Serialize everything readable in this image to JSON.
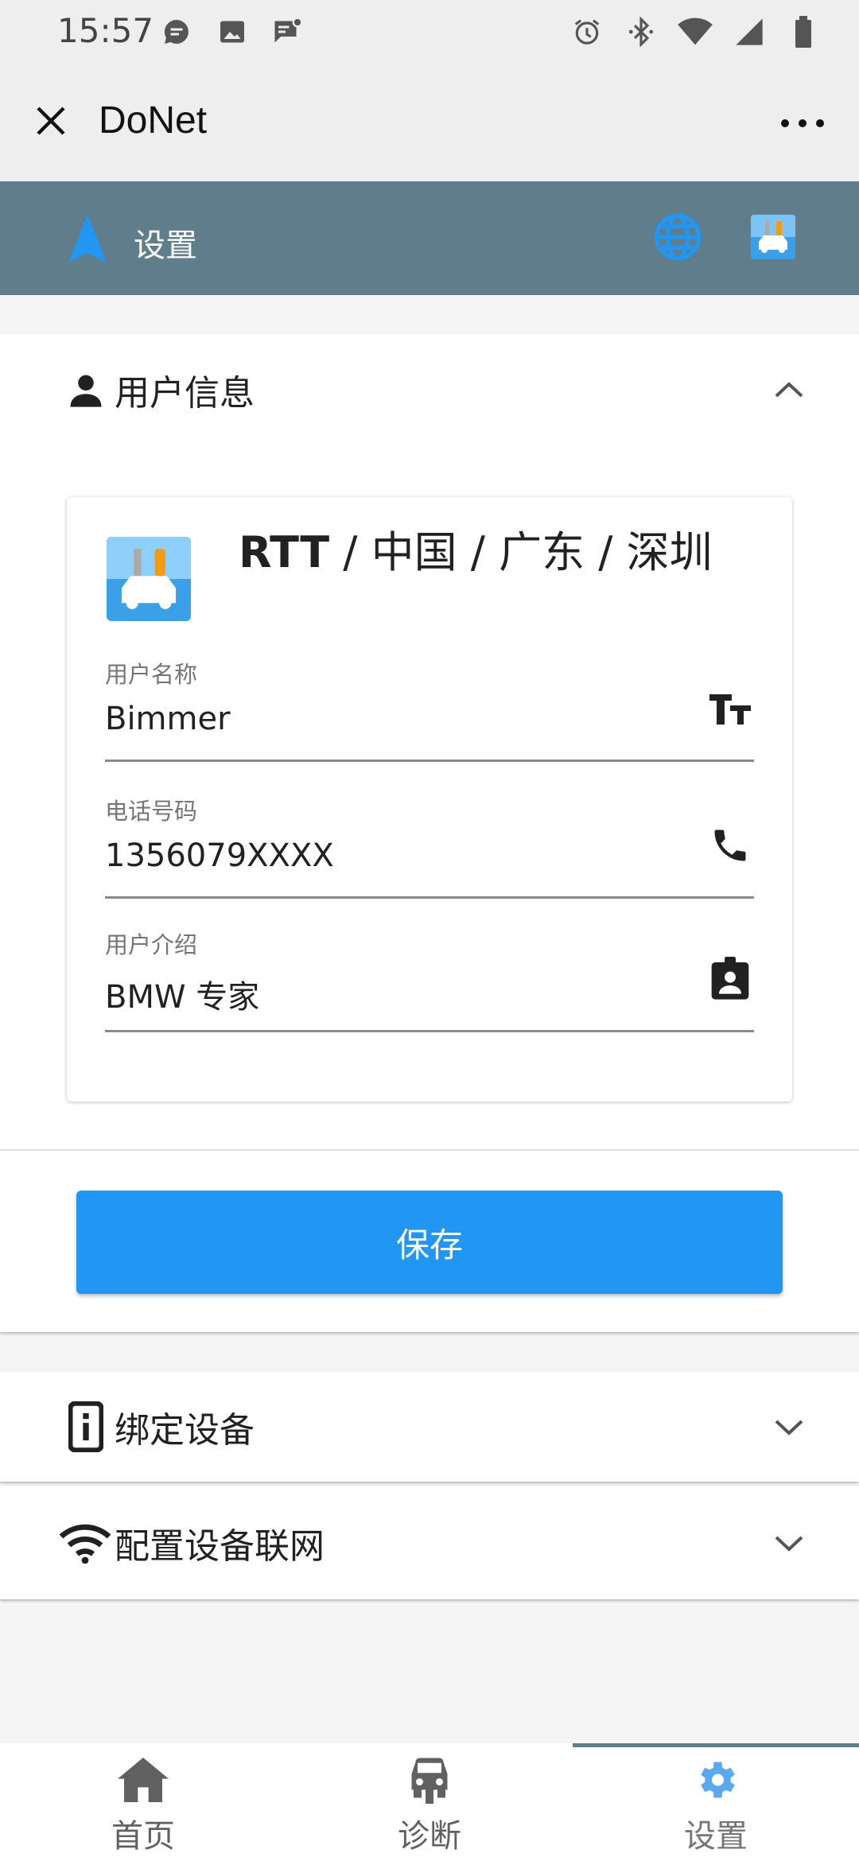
{
  "status_bar": {
    "time": "15:57",
    "left_icons": [
      "message-icon",
      "image-icon",
      "chat-badge-icon"
    ],
    "right_icons": [
      "alarm-icon",
      "bluetooth-icon",
      "wifi-icon",
      "signal-icon",
      "battery-icon"
    ]
  },
  "titlebar": {
    "title": "DoNet",
    "close_icon": "close-icon",
    "more_icon": "more-horizontal-icon"
  },
  "appbar": {
    "title": "设置",
    "nav_icon": "navigation-arrow-icon",
    "globe_icon": "globe-icon",
    "avatar_icon": "app-logo-icon"
  },
  "user_panel": {
    "header": "用户信息",
    "expanded": true,
    "location_bold": "RTT",
    "location_rest": " / 中国 / 广东 / 深圳",
    "fields": [
      {
        "label": "用户名称",
        "value": "Bimmer",
        "icon": "text-size-icon"
      },
      {
        "label": "电话号码",
        "value": "1356079XXXX",
        "icon": "phone-icon"
      },
      {
        "label": "用户介绍",
        "value": "BMW 专家",
        "icon": "contact-card-icon"
      }
    ],
    "save_label": "保存"
  },
  "bind_panel": {
    "header": "绑定设备",
    "expanded": false
  },
  "wifi_panel": {
    "header": "配置设备联网",
    "expanded": false
  },
  "bottom_nav": {
    "items": [
      {
        "label": "首页",
        "icon": "home-icon"
      },
      {
        "label": "诊断",
        "icon": "car-icon"
      },
      {
        "label": "设置",
        "icon": "gear-icon"
      }
    ],
    "active_index": 2
  },
  "colors": {
    "appbar": "#607d8b",
    "accent": "#2196f3",
    "background": "#f5f5f5"
  }
}
